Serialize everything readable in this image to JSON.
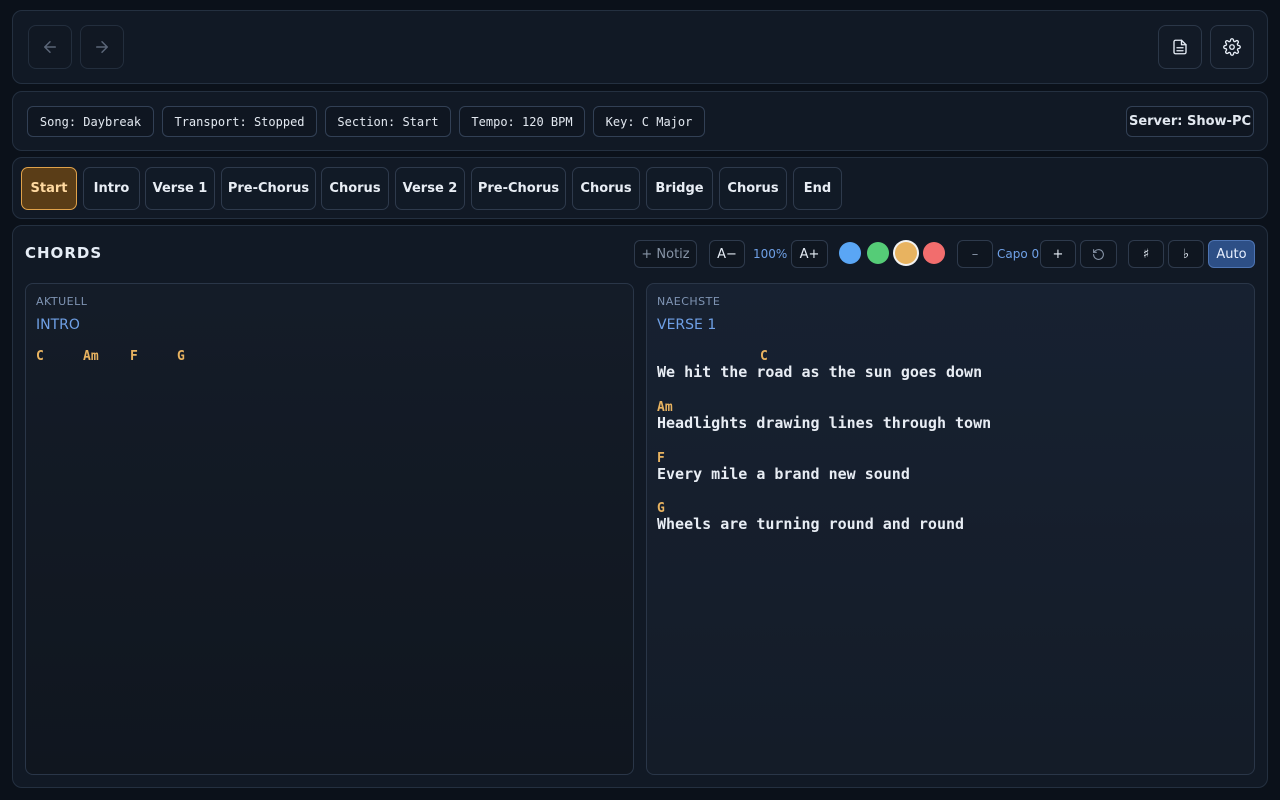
{
  "nav": {
    "back_icon": "arrow-left-icon",
    "forward_icon": "arrow-right-icon",
    "document_icon": "document-icon",
    "settings_icon": "gear-icon"
  },
  "status": {
    "song": "Song: Daybreak",
    "transport": "Transport: Stopped",
    "section": "Section: Start",
    "tempo": "Tempo: 120 BPM",
    "key": "Key: C Major",
    "server": "Server: Show-PC"
  },
  "sections": [
    {
      "label": "Start",
      "active": true
    },
    {
      "label": "Intro"
    },
    {
      "label": "Verse 1"
    },
    {
      "label": "Pre-Chorus"
    },
    {
      "label": "Chorus"
    },
    {
      "label": "Verse 2"
    },
    {
      "label": "Pre-Chorus"
    },
    {
      "label": "Chorus"
    },
    {
      "label": "Bridge"
    },
    {
      "label": "Chorus"
    },
    {
      "label": "End"
    }
  ],
  "chords": {
    "title": "CHORDS",
    "toolbar": {
      "note_label": "+ Notiz",
      "font_down": "A−",
      "zoom": "100%",
      "font_up": "A+",
      "colors": [
        "#5aa6f5",
        "#55cc77",
        "#e8b360",
        "#f26d6d"
      ],
      "selected_color": "#e8b360",
      "capo_minus": "–",
      "capo_label": "Capo 0",
      "capo_plus": "+",
      "reset_icon": "reset-icon",
      "sharp": "♯",
      "flat": "♭",
      "auto": "Auto"
    },
    "current": {
      "label": "AKTUELL",
      "section": "INTRO",
      "chords": [
        "C",
        "Am",
        "F",
        "G"
      ]
    },
    "next": {
      "label": "NAECHSTE",
      "section": "VERSE 1",
      "lines": [
        {
          "chord": "C",
          "lyric": "We hit the road as the sun goes down"
        },
        {
          "chord": "Am",
          "lyric": "Headlights drawing lines through town"
        },
        {
          "chord": "F",
          "lyric": "Every mile a brand new sound"
        },
        {
          "chord": "G",
          "lyric": "Wheels are turning round and round"
        }
      ]
    }
  }
}
